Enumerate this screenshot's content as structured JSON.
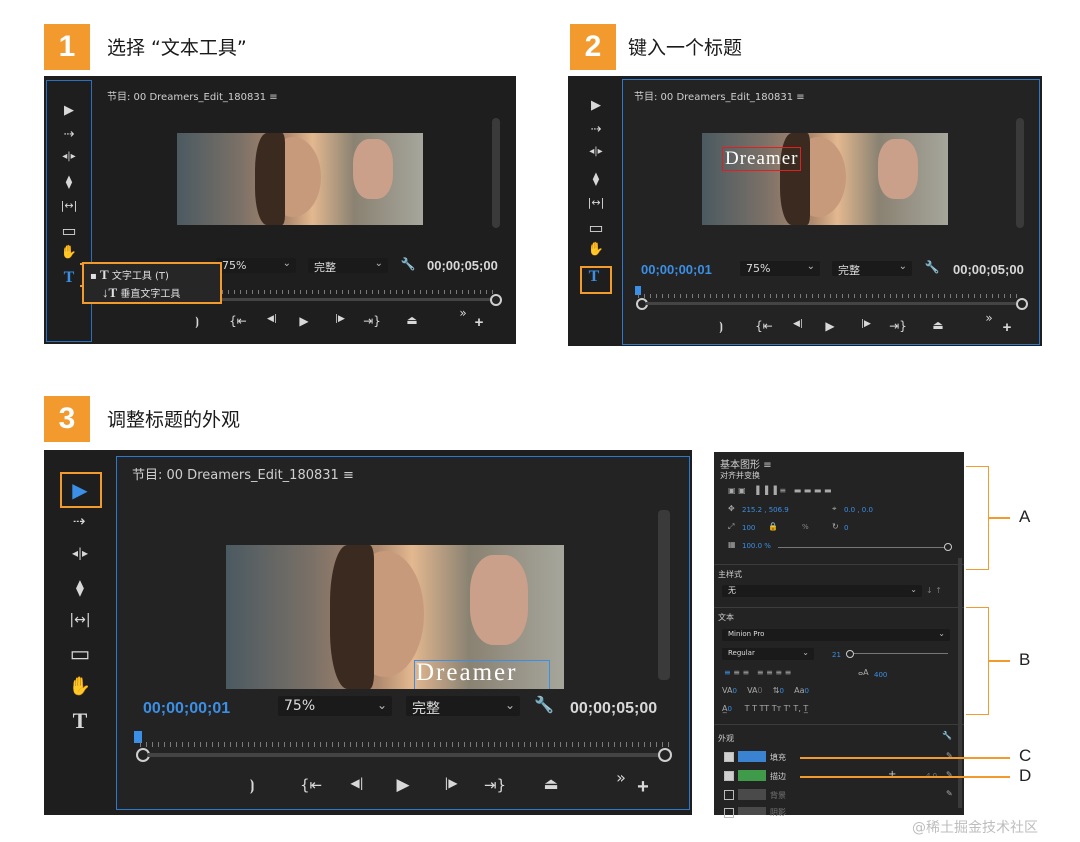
{
  "steps": [
    {
      "number": "1",
      "title": "选择 “文本工具”"
    },
    {
      "number": "2",
      "title": "键入一个标题"
    },
    {
      "number": "3",
      "title": "调整标题的外观"
    }
  ],
  "program_monitor": {
    "title": "节目: 00 Dreamers_Edit_180831",
    "menu_icon": "≡",
    "timecode_current": "00;00;00;01",
    "timecode_total": "00;00;05;00",
    "zoom": "75%",
    "quality": "完整",
    "title_text": "Dreamer"
  },
  "tools": {
    "selection": "▶",
    "track_select": "⇢",
    "ripple": "◂|▸",
    "razor": "⧫",
    "slip": "|↔|",
    "rectangle": "▭",
    "hand": "✋",
    "type": "T"
  },
  "type_menu": {
    "item1": "文字工具 (T)",
    "item2": "垂直文字工具"
  },
  "transport": {
    "mark_in": "⦘",
    "go_in": "{⇤",
    "step_back": "◀|",
    "play": "▶",
    "step_fwd": "|▶",
    "go_out": "⇥}",
    "export": "⏏",
    "more": "»",
    "add": "+"
  },
  "essential_graphics": {
    "title": "基本图形",
    "menu_icon": "≡",
    "align_label": "对齐并变换",
    "position": "215.2 , 506.9",
    "anchor": "0.0 , 0.0",
    "scale": "100",
    "scale_unit": "%",
    "rotation": "0",
    "opacity": "100.0 %",
    "master_style_label": "主样式",
    "master_style_value": "无",
    "text_label": "文本",
    "font": "Minion Pro",
    "font_style": "Regular",
    "font_size": "21",
    "tracking_value": "400",
    "appearance_label": "外观",
    "fill_label": "填充",
    "stroke_label": "描边",
    "background_label": "背景",
    "shadow_label": "阴影",
    "stroke_width": "4.0",
    "zero": "0",
    "text_styles": "T  T  TT Tт  T'  T,  T̲"
  },
  "callouts": {
    "a": "A",
    "b": "B",
    "c": "C",
    "d": "D"
  },
  "watermark": "@稀土掘金技术社区",
  "colors": {
    "accent": "#f29a2e",
    "blue": "#2d79cf",
    "fill": "#3a83d1",
    "stroke": "#3f9a4a"
  }
}
